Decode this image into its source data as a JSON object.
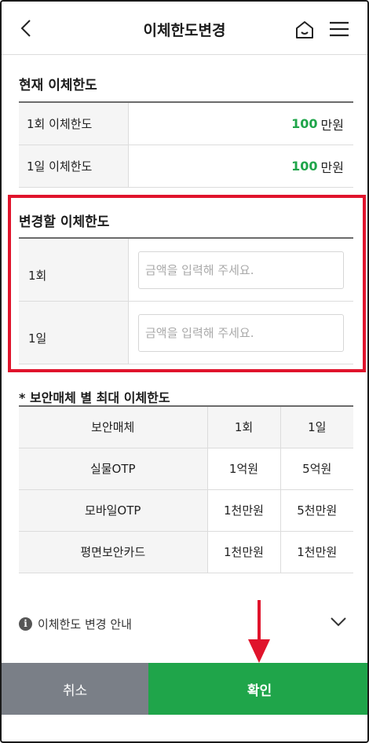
{
  "header": {
    "title": "이체한도변경",
    "back_icon": "chevron-left-icon",
    "home_icon": "home-icon",
    "menu_icon": "hamburger-menu-icon"
  },
  "current_limit": {
    "title": "현재 이체한도",
    "rows": [
      {
        "label": "1회 이체한도",
        "amount": "100",
        "unit": "만원"
      },
      {
        "label": "1일 이체한도",
        "amount": "100",
        "unit": "만원"
      }
    ]
  },
  "change_limit": {
    "title": "변경할 이체한도",
    "rows": [
      {
        "label": "1회",
        "placeholder": "금액을 입력해 주세요.",
        "value": ""
      },
      {
        "label": "1일",
        "placeholder": "금액을 입력해 주세요.",
        "value": ""
      }
    ]
  },
  "security_limits": {
    "title": "* 보안매체 별 최대 이체한도",
    "headers": [
      "보안매체",
      "1회",
      "1일"
    ],
    "rows": [
      [
        "실물OTP",
        "1억원",
        "5억원"
      ],
      [
        "모바일OTP",
        "1천만원",
        "5천만원"
      ],
      [
        "평면보안카드",
        "1천만원",
        "1천만원"
      ]
    ]
  },
  "info": {
    "icon_glyph": "i",
    "text": "이체한도 변경 안내"
  },
  "buttons": {
    "cancel": "취소",
    "confirm": "확인"
  },
  "colors": {
    "accent_green": "#1fa54a",
    "cancel_gray": "#7a7f87",
    "highlight_red": "#e0142c"
  }
}
